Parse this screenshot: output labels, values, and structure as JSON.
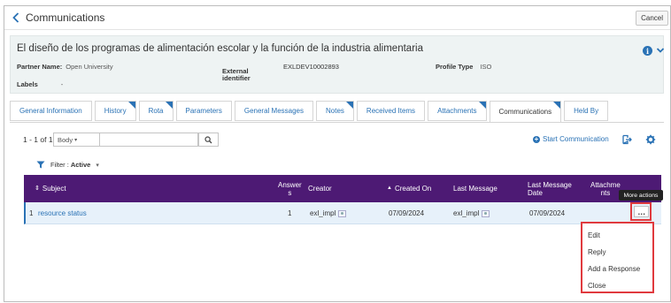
{
  "titlebar": {
    "title": "Communications",
    "cancel_label": "Cancel"
  },
  "header": {
    "record_title": "El diseño de los programas de alimentación escolar y la función de la industria alimentaria",
    "partner_label": "Partner Name:",
    "partner_value": "Open University",
    "external_label_1": "External",
    "external_label_2": "identifier",
    "external_value": "EXLDEV10002893",
    "profile_label": "Profile Type",
    "profile_value": "ISO",
    "labels_label": "Labels",
    "labels_value": "-"
  },
  "tabs": [
    {
      "label": "General Information",
      "flag": false,
      "active": false
    },
    {
      "label": "History",
      "flag": true,
      "active": false
    },
    {
      "label": "Rota",
      "flag": true,
      "active": false
    },
    {
      "label": "Parameters",
      "flag": false,
      "active": false
    },
    {
      "label": "General Messages",
      "flag": false,
      "active": false
    },
    {
      "label": "Notes",
      "flag": true,
      "active": false
    },
    {
      "label": "Received Items",
      "flag": false,
      "active": false
    },
    {
      "label": "Attachments",
      "flag": true,
      "active": false
    },
    {
      "label": "Communications",
      "flag": true,
      "active": true
    },
    {
      "label": "Held By",
      "flag": false,
      "active": false
    }
  ],
  "toolbar": {
    "count": "1 - 1 of 1",
    "body_select": "Body",
    "search_value": "",
    "start_communication": "Start Communication"
  },
  "filter": {
    "label": "Filter :",
    "value": "Active"
  },
  "table": {
    "headers": {
      "subject": "Subject",
      "answers_1": "Answer",
      "answers_2": "s",
      "creator": "Creator",
      "created_on": "Created On",
      "last_message": "Last Message",
      "last_date_1": "Last Message",
      "last_date_2": "Date",
      "attach_1": "Attachme",
      "attach_2": "nts"
    },
    "row": {
      "index": "1",
      "subject": "resource status",
      "answers": "1",
      "creator": "exl_impl",
      "created_on": "07/09/2024",
      "last_message": "exl_impl",
      "last_date": "07/09/2024"
    }
  },
  "more_actions": {
    "tooltip": "More actions",
    "button": "…",
    "menu": [
      "Edit",
      "Reply",
      "Add a Response",
      "Close"
    ]
  },
  "colors": {
    "accent": "#2a72b5",
    "header_bg": "#4d1a74",
    "highlight": "#e03a3e"
  }
}
